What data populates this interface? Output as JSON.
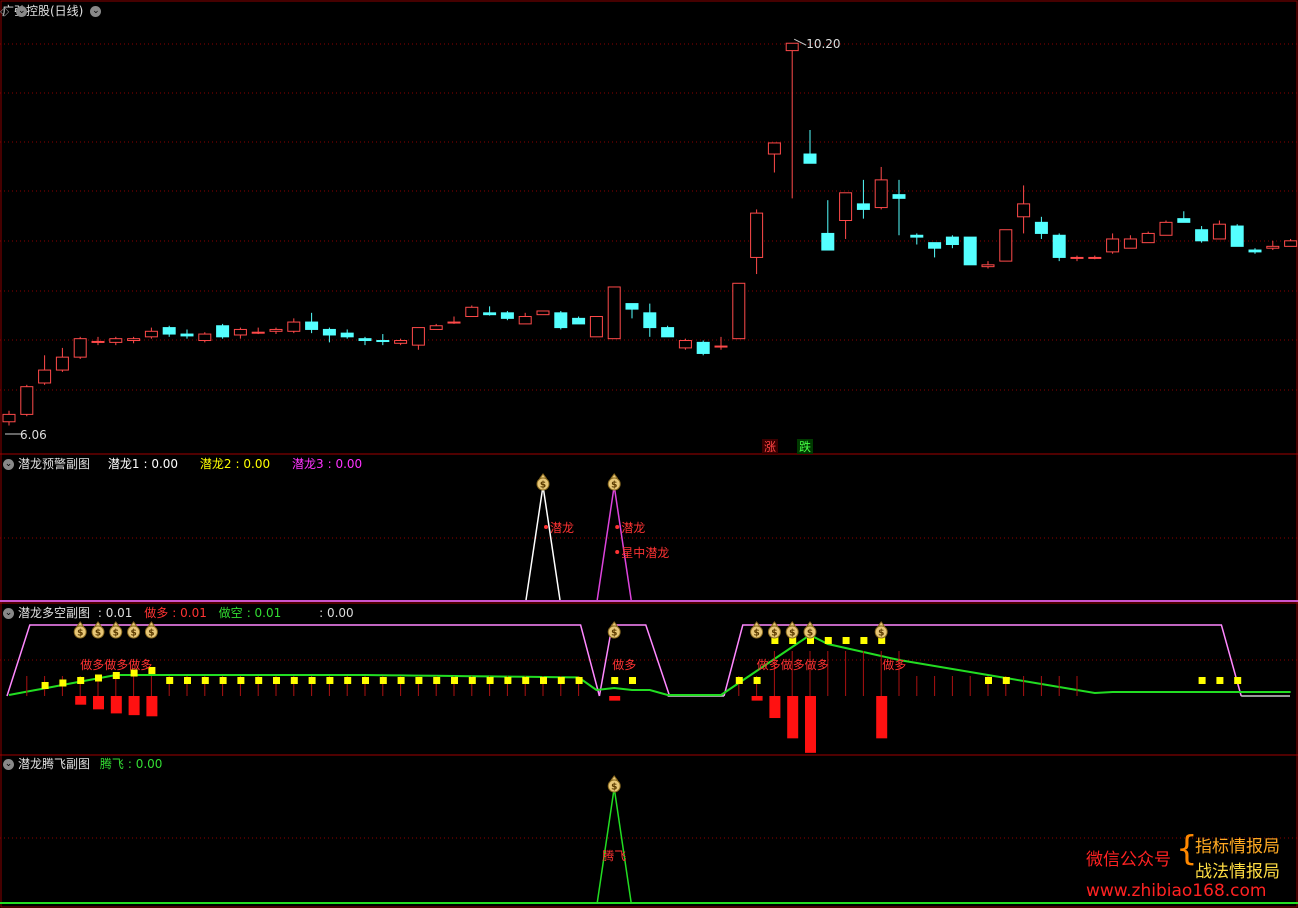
{
  "main": {
    "title": "广弘控股(日线)",
    "high_label": "10.20",
    "low_label": "6.06",
    "zhang_label": "涨",
    "die_label": "跌",
    "corner_icons": [
      "diamond-icon",
      "settings-icon"
    ]
  },
  "panel1": {
    "title": "潜龙预警副图",
    "legend": [
      {
        "name": "潜龙1",
        "value": "0.00",
        "color": "#ffffff"
      },
      {
        "name": "潜龙2",
        "value": "0.00",
        "color": "#ffff00"
      },
      {
        "name": "潜龙3",
        "value": "0.00",
        "color": "#ff00ff"
      }
    ],
    "labels": [
      "潜龙",
      "潜龙",
      "星中潜龙"
    ]
  },
  "panel2": {
    "title": "潜龙多空副图",
    "first_value": "0.01",
    "legend": [
      {
        "name": "做多",
        "value": "0.01",
        "color": "#ff3333"
      },
      {
        "name": "做空",
        "value": "0.01",
        "color": "#33dd33"
      },
      {
        "name": "",
        "value": "0.00",
        "color": "#dddddd"
      }
    ],
    "labels": [
      "做多做多做多",
      "做多",
      "做多做多做多",
      "做多"
    ]
  },
  "panel3": {
    "title": "潜龙腾飞副图",
    "legend": [
      {
        "name": "腾飞",
        "value": "0.00",
        "color": "#33dd33"
      }
    ],
    "label": "腾飞"
  },
  "watermark": {
    "line1": "微信公众号",
    "line2a": "指标情报局",
    "line2b": "战法情报局",
    "url": "www.zhibiao168.com"
  },
  "chart_data": {
    "type": "candlestick",
    "ylim": [
      6.0,
      10.3
    ],
    "high_marker": 10.2,
    "low_marker": 6.06,
    "candles": [
      [
        6.1,
        6.18,
        6.06,
        6.22
      ],
      [
        6.18,
        6.48,
        6.16,
        6.5
      ],
      [
        6.52,
        6.66,
        6.5,
        6.82
      ],
      [
        6.66,
        6.8,
        6.64,
        6.9
      ],
      [
        6.8,
        7.0,
        6.78,
        7.02
      ],
      [
        6.97,
        6.97,
        6.93,
        7.02
      ],
      [
        6.96,
        7.0,
        6.93,
        7.02
      ],
      [
        6.98,
        7.0,
        6.95,
        7.02
      ],
      [
        7.02,
        7.08,
        7.0,
        7.12
      ],
      [
        7.12,
        7.05,
        7.02,
        7.14
      ],
      [
        7.05,
        7.03,
        7.0,
        7.1
      ],
      [
        6.98,
        7.05,
        6.96,
        7.07
      ],
      [
        7.14,
        7.02,
        7.0,
        7.16
      ],
      [
        7.04,
        7.1,
        7.0,
        7.12
      ],
      [
        7.07,
        7.07,
        7.05,
        7.12
      ],
      [
        7.08,
        7.1,
        7.05,
        7.12
      ],
      [
        7.08,
        7.18,
        7.06,
        7.22
      ],
      [
        7.18,
        7.1,
        7.06,
        7.28
      ],
      [
        7.1,
        7.04,
        6.96,
        7.12
      ],
      [
        7.06,
        7.02,
        7.0,
        7.1
      ],
      [
        7.0,
        6.98,
        6.93,
        7.02
      ],
      [
        6.98,
        6.97,
        6.93,
        7.05
      ],
      [
        6.95,
        6.98,
        6.93,
        7.0
      ],
      [
        6.93,
        7.12,
        6.88,
        7.12
      ],
      [
        7.1,
        7.14,
        7.1,
        7.16
      ],
      [
        7.17,
        7.18,
        7.16,
        7.24
      ],
      [
        7.24,
        7.34,
        7.24,
        7.36
      ],
      [
        7.28,
        7.26,
        7.25,
        7.35
      ],
      [
        7.28,
        7.22,
        7.2,
        7.3
      ],
      [
        7.16,
        7.24,
        7.16,
        7.28
      ],
      [
        7.26,
        7.3,
        7.26,
        7.3
      ],
      [
        7.28,
        7.12,
        7.1,
        7.3
      ],
      [
        7.22,
        7.16,
        7.16,
        7.24
      ],
      [
        7.02,
        7.24,
        7.02,
        7.24
      ],
      [
        7.0,
        7.56,
        7.0,
        7.56
      ],
      [
        7.38,
        7.32,
        7.22,
        7.38
      ],
      [
        7.28,
        7.12,
        7.02,
        7.38
      ],
      [
        7.12,
        7.02,
        7.02,
        7.14
      ],
      [
        6.9,
        6.98,
        6.88,
        7.0
      ],
      [
        6.96,
        6.84,
        6.82,
        6.98
      ],
      [
        6.92,
        6.92,
        6.88,
        7.02
      ],
      [
        7.0,
        7.6,
        7.0,
        7.6
      ],
      [
        7.88,
        8.36,
        7.7,
        8.4
      ],
      [
        9.0,
        9.12,
        8.8,
        9.12
      ],
      [
        10.12,
        10.2,
        8.52,
        10.2
      ],
      [
        9.0,
        8.9,
        8.9,
        9.26
      ],
      [
        8.14,
        7.96,
        7.96,
        8.5
      ],
      [
        8.28,
        8.58,
        8.08,
        8.58
      ],
      [
        8.46,
        8.4,
        8.3,
        8.72
      ],
      [
        8.42,
        8.72,
        8.4,
        8.86
      ],
      [
        8.56,
        8.52,
        8.12,
        8.72
      ],
      [
        8.12,
        8.1,
        8.02,
        8.14
      ],
      [
        8.04,
        7.98,
        7.88,
        8.04
      ],
      [
        8.1,
        8.02,
        7.98,
        8.12
      ],
      [
        8.1,
        7.8,
        7.8,
        8.1
      ],
      [
        7.78,
        7.8,
        7.76,
        7.84
      ],
      [
        7.84,
        8.18,
        7.84,
        8.18
      ],
      [
        8.32,
        8.46,
        8.14,
        8.66
      ],
      [
        8.26,
        8.14,
        8.08,
        8.32
      ],
      [
        8.12,
        7.88,
        7.84,
        8.14
      ],
      [
        7.88,
        7.88,
        7.84,
        7.9
      ],
      [
        7.88,
        7.88,
        7.86,
        7.9
      ],
      [
        7.94,
        8.08,
        7.92,
        8.14
      ],
      [
        7.98,
        8.08,
        7.98,
        8.12
      ],
      [
        8.04,
        8.14,
        8.04,
        8.16
      ],
      [
        8.12,
        8.26,
        8.12,
        8.28
      ],
      [
        8.3,
        8.26,
        8.26,
        8.38
      ],
      [
        8.18,
        8.06,
        8.04,
        8.22
      ],
      [
        8.08,
        8.24,
        8.08,
        8.28
      ],
      [
        8.22,
        8.0,
        8.0,
        8.24
      ],
      [
        7.96,
        7.94,
        7.92,
        7.98
      ],
      [
        7.98,
        8.0,
        7.96,
        8.06
      ],
      [
        8.0,
        8.06,
        8.0,
        8.08
      ]
    ],
    "panel1_peaks": [
      30,
      34
    ],
    "panel3_peak": 34,
    "panel2_yellow_markers": [
      2,
      3,
      4,
      5,
      6,
      7,
      8,
      9,
      10,
      11,
      12,
      13,
      14,
      15,
      16,
      17,
      18,
      19,
      20,
      21,
      22,
      23,
      24,
      25,
      26,
      27,
      28,
      29,
      30,
      31,
      32,
      34,
      35,
      41,
      42,
      43,
      44,
      45,
      46,
      47,
      48,
      49,
      55,
      56,
      67,
      68,
      69
    ],
    "panel2_red_bars": [
      [
        4,
        0.15
      ],
      [
        5,
        0.23
      ],
      [
        6,
        0.3
      ],
      [
        7,
        0.33
      ],
      [
        8,
        0.35
      ],
      [
        34,
        0.08
      ],
      [
        42,
        0.08
      ],
      [
        43,
        0.38
      ],
      [
        44,
        0.73
      ],
      [
        45,
        0.98
      ],
      [
        49,
        0.73
      ]
    ],
    "panel2_moneybags": [
      4,
      5,
      6,
      7,
      8,
      34,
      42,
      43,
      44,
      45,
      49
    ]
  }
}
